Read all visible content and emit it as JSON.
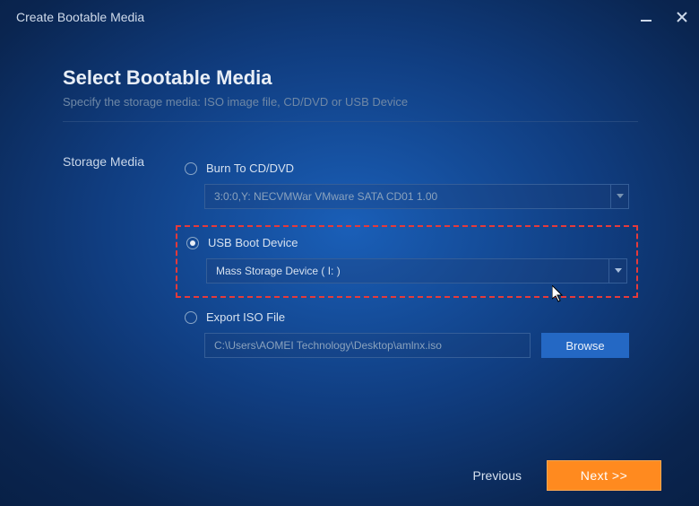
{
  "titlebar": {
    "title": "Create Bootable Media"
  },
  "page": {
    "heading": "Select Bootable Media",
    "subheading": "Specify the storage media: ISO image file, CD/DVD or USB Device",
    "side_label": "Storage Media"
  },
  "options": {
    "cd": {
      "label": "Burn To CD/DVD",
      "value": "3:0:0,Y: NECVMWar VMware SATA CD01 1.00",
      "selected": false
    },
    "usb": {
      "label": "USB Boot Device",
      "value": "Mass   Storage Device  ( I: )",
      "selected": true
    },
    "iso": {
      "label": "Export ISO File",
      "path": "C:\\Users\\AOMEI Technology\\Desktop\\amlnx.iso",
      "browse": "Browse",
      "selected": false
    }
  },
  "footer": {
    "previous": "Previous",
    "next": "Next >>"
  }
}
